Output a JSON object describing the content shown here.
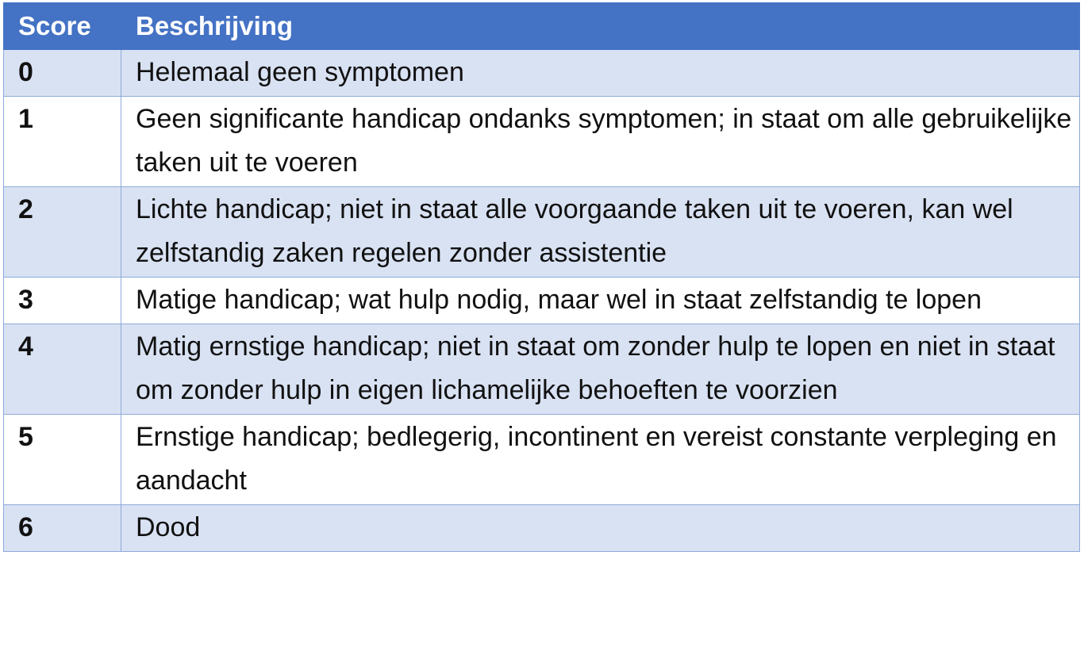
{
  "table": {
    "headers": [
      "Score",
      "Beschrijving"
    ],
    "rows": [
      {
        "score": "0",
        "description": "Helemaal geen symptomen"
      },
      {
        "score": "1",
        "description": "Geen significante handicap ondanks symptomen; in staat om alle gebruikelijke taken uit te voeren"
      },
      {
        "score": "2",
        "description": "Lichte handicap; niet in staat alle voorgaande taken uit te voeren, kan wel zelfstandig zaken regelen zonder assistentie"
      },
      {
        "score": "3",
        "description": "Matige handicap; wat hulp nodig, maar wel in staat zelfstandig te lopen"
      },
      {
        "score": "4",
        "description": "Matig ernstige handicap; niet in staat om zonder hulp te lopen en niet in staat om zonder hulp in eigen lichamelijke behoeften te voorzien"
      },
      {
        "score": "5",
        "description": "Ernstige handicap; bedlegerig, incontinent en vereist constante verpleging en aandacht"
      },
      {
        "score": "6",
        "description": "Dood"
      }
    ]
  },
  "colors": {
    "header_bg": "#4472c4",
    "header_text": "#ffffff",
    "band_row": "#d9e2f3",
    "plain_row": "#ffffff",
    "border": "#8eaadb"
  }
}
